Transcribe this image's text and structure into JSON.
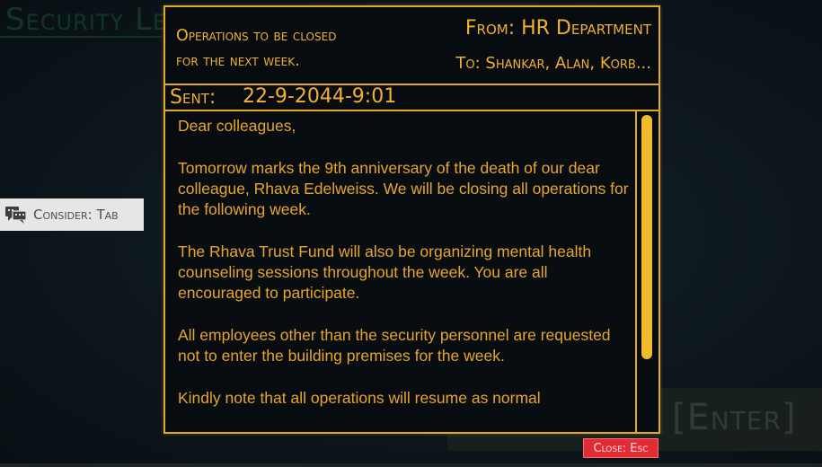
{
  "background": {
    "title": "Security Le",
    "enter_hint": "[Enter]"
  },
  "consider_hint": {
    "icon": "speech-bubbles-icon",
    "label": "Consider: Tab"
  },
  "document": {
    "subject": "Operations to be closed\nfor the next week.",
    "from": "From: HR Department",
    "to": "To: Shankar, Alan, Korb...",
    "sent_label": "Sent:",
    "sent_date": "22-9-2044-9:01",
    "paragraphs": [
      "Dear colleagues,",
      "Tomorrow marks the 9th anniversary of the death of our dear colleague, Rhava Edelweiss. We will be closing all operations for the following week.",
      "The Rhava Trust Fund will also be organizing mental health counseling sessions throughout the week. You are all encouraged to participate.",
      "All employees other than the security personnel are requested not to enter the building premises for the week.",
      "Kindly note that all operations will resume as normal"
    ]
  },
  "close_button": {
    "label": "Close: Esc"
  },
  "colors": {
    "accent": "#f0b030",
    "close": "#e12b35"
  }
}
